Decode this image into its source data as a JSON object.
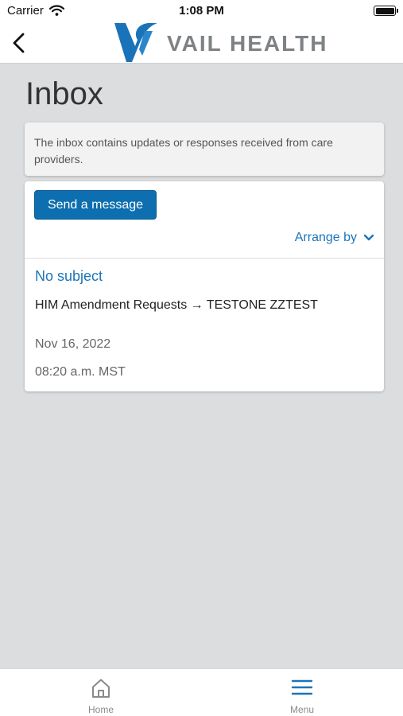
{
  "status_bar": {
    "carrier": "Carrier",
    "time": "1:08 PM",
    "icons": [
      "wifi-icon",
      "battery-icon"
    ]
  },
  "nav": {
    "back_icon": "chevron-left-icon",
    "logo_text": "VAIL HEALTH",
    "logo_mark_color": "#1a73b8",
    "logo_text_color": "#7e8284"
  },
  "page": {
    "title": "Inbox",
    "info_text": "The inbox contains updates or responses received from care providers."
  },
  "inbox": {
    "send_button_label": "Send a message",
    "arrange_label": "Arrange by",
    "arrange_icon": "chevron-down-icon",
    "messages": [
      {
        "subject": "No subject",
        "route": "HIM Amendment Requests → TESTONE ZZTEST",
        "date": "Nov 16, 2022",
        "time": "08:20 a.m. MST"
      }
    ]
  },
  "tab_bar": {
    "items": [
      {
        "label": "Home",
        "icon": "home-icon"
      },
      {
        "label": "Menu",
        "icon": "menu-icon"
      }
    ]
  },
  "colors": {
    "accent": "#1c75b8",
    "button": "#0d6fb0",
    "background": "#dcdddf",
    "active_tab": "#1c75b8",
    "inactive_tab": "#8a8a8a"
  }
}
